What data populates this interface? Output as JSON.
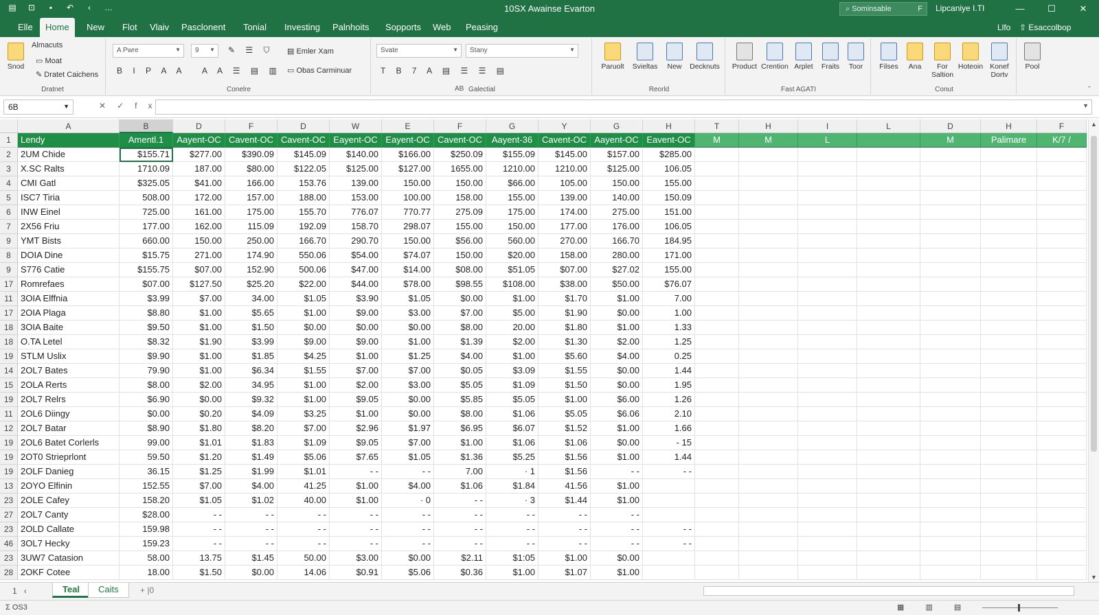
{
  "titlebar": {
    "quick_access_icons": [
      "excel-logo-icon",
      "autosave-icon",
      "save-icon",
      "undo-icon",
      "redo-icon",
      "more-icon"
    ],
    "quick_glyphs": [
      "▤",
      "⊡",
      "▪",
      "↶",
      "‹",
      "…"
    ],
    "title": "10SX Awainse Evarton",
    "search_placeholder": "Sominsable",
    "search_key": "F",
    "user": "Lipcaniye I.TI",
    "window_controls": [
      "—",
      "☐",
      "✕"
    ]
  },
  "tabs": [
    "Elle",
    "Home",
    "New",
    "Flot",
    "Vlaiv",
    "Pasclonent",
    "Tonial",
    "Investing",
    "Palnhoits",
    "Sopports",
    "Web",
    "Peasing"
  ],
  "active_tab": "Home",
  "tabs_right": [
    "Llfo",
    "Esaccolbop"
  ],
  "ribbon": {
    "clipboard": {
      "paste_label": "Snod",
      "items": [
        "Almacuts",
        "Moat",
        "Dratet Caichens"
      ],
      "group_label": "Dratnet"
    },
    "font": {
      "font_name": "A Pwre",
      "font_size": "9",
      "row1_glyphs": "✎ ☰ ⛉",
      "row2_glyphs": "B I P A A",
      "row3_glyphs": "A A ☰ ▤ ▥",
      "enter_label": "Emler Xam",
      "obas_label": "Obas Carminuar",
      "group_label": "Conelre"
    },
    "alignment": {
      "combo1": "Svate",
      "combo2": "Stany",
      "row_glyphs": "T B 7 A ▤ ☰ ☰ ▤",
      "label_ab": "AB",
      "group_label": "Galectial"
    },
    "records": {
      "buttons": [
        "Paruolt",
        "Svieltas",
        "New",
        "Decknuts"
      ],
      "group_label": "Reorld"
    },
    "fast": {
      "buttons": [
        "Product",
        "Crention",
        "Arplet",
        "Fraits",
        "Toor"
      ],
      "group_label": "Fast AGATI"
    },
    "count": {
      "buttons": [
        "Filses",
        "Ana",
        "For Saltion",
        "Hoteoin",
        "Konef Dortv"
      ],
      "group_label": "Conut"
    },
    "pool": {
      "buttons": [
        "Pool"
      ]
    }
  },
  "formula_bar": {
    "name_box": "6B",
    "icons": [
      "✕",
      "✓",
      "fx"
    ],
    "formula": ""
  },
  "columns": [
    "A",
    "B",
    "D",
    "F",
    "D",
    "W",
    "E",
    "F",
    "G",
    "Y",
    "G",
    "H",
    "T",
    "H",
    "I",
    "L",
    "D",
    "H",
    "F"
  ],
  "selected_column_index": 1,
  "header_row": {
    "row_num": "1",
    "cells": [
      "Lendy",
      "Amentl.1",
      "Aayent-OC",
      "Cavent-OC",
      "Cavent-OC",
      "Eayent-OC",
      "Eayent-OC",
      "Cavent-OC",
      "Aayent-36",
      "Cavent-OC",
      "Aayent-OC",
      "Eavent-OC",
      "M",
      "M",
      "L",
      "",
      "M",
      "Palimare",
      "K/7 /"
    ]
  },
  "rows": [
    {
      "n": "2",
      "cells": [
        "2UM Chide",
        "$155.71",
        "$277.00",
        "$390.09",
        "$145.09",
        "$140.00",
        "$166.00",
        "$250.09",
        "$155.09",
        "$145.00",
        "$157.00",
        "$285.00"
      ]
    },
    {
      "n": "3",
      "cells": [
        "X.SC Ralts",
        "1710.09",
        "187.00",
        "$80.00",
        "$122.05",
        "$125.00",
        "$127.00",
        "1655.00",
        "1210.00",
        "1210.00",
        "$125.00",
        "106.05"
      ]
    },
    {
      "n": "4",
      "cells": [
        "CMI Gatl",
        "$325.05",
        "$41.00",
        "166.00",
        "153.76",
        "139.00",
        "150.00",
        "150.00",
        "$66.00",
        "105.00",
        "150.00",
        "155.00"
      ]
    },
    {
      "n": "5",
      "cells": [
        "ISC7 Tiria",
        "508.00",
        "172.00",
        "157.00",
        "188.00",
        "153.00",
        "100.00",
        "158.00",
        "155.00",
        "139.00",
        "140.00",
        "150.09"
      ]
    },
    {
      "n": "6",
      "cells": [
        "INW Einel",
        "725.00",
        "161.00",
        "175.00",
        "155.70",
        "776.07",
        "770.77",
        "275.09",
        "175.00",
        "174.00",
        "275.00",
        "151.00"
      ]
    },
    {
      "n": "7",
      "cells": [
        "2X56 Friu",
        "177.00",
        "162.00",
        "115.09",
        "192.09",
        "158.70",
        "298.07",
        "155.00",
        "150.00",
        "177.00",
        "176.00",
        "106.05"
      ]
    },
    {
      "n": "9",
      "cells": [
        "YMT Bists",
        "660.00",
        "150.00",
        "250.00",
        "166.70",
        "290.70",
        "150.00",
        "$56.00",
        "560.00",
        "270.00",
        "166.70",
        "184.95"
      ]
    },
    {
      "n": "8",
      "cells": [
        "DOIA Dine",
        "$15.75",
        "271.00",
        "174.90",
        "550.06",
        "$54.00",
        "$74.07",
        "150.00",
        "$20.00",
        "158.00",
        "280.00",
        "171.00"
      ]
    },
    {
      "n": "9",
      "cells": [
        "S776 Catie",
        "$155.75",
        "$07.00",
        "152.90",
        "500.06",
        "$47.00",
        "$14.00",
        "$08.00",
        "$51.05",
        "$07.00",
        "$27.02",
        "155.00"
      ]
    },
    {
      "n": "17",
      "cells": [
        "Romrefaes",
        "$07.00",
        "$127.50",
        "$25.20",
        "$22.00",
        "$44.00",
        "$78.00",
        "$98.55",
        "$108.00",
        "$38.00",
        "$50.00",
        "$76.07"
      ]
    },
    {
      "n": "11",
      "cells": [
        "3OIA Elffnia",
        "$3.99",
        "$7.00",
        "34.00",
        "$1.05",
        "$3.90",
        "$1.05",
        "$0.00",
        "$1.00",
        "$1.70",
        "$1.00",
        "7.00"
      ]
    },
    {
      "n": "17",
      "cells": [
        "2OIA Plaga",
        "$8.80",
        "$1.00",
        "$5.65",
        "$1.00",
        "$9.00",
        "$3.00",
        "$7.00",
        "$5.00",
        "$1.90",
        "$0.00",
        "1.00"
      ]
    },
    {
      "n": "18",
      "cells": [
        "3OIA Baite",
        "$9.50",
        "$1.00",
        "$1.50",
        "$0.00",
        "$0.00",
        "$0.00",
        "$8.00",
        "20.00",
        "$1.80",
        "$1.00",
        "1.33"
      ]
    },
    {
      "n": "18",
      "cells": [
        "O.TA Letel",
        "$8.32",
        "$1.90",
        "$3.99",
        "$9.00",
        "$9.00",
        "$1.00",
        "$1.39",
        "$2.00",
        "$1.30",
        "$2.00",
        "1.25"
      ]
    },
    {
      "n": "19",
      "cells": [
        "STLM Uslix",
        "$9.90",
        "$1.00",
        "$1.85",
        "$4.25",
        "$1.00",
        "$1.25",
        "$4.00",
        "$1.00",
        "$5.60",
        "$4.00",
        "0.25"
      ]
    },
    {
      "n": "14",
      "cells": [
        "2OL7 Bates",
        "79.90",
        "$1.00",
        "$6.34",
        "$1.55",
        "$7.00",
        "$7.00",
        "$0.05",
        "$3.09",
        "$1.55",
        "$0.00",
        "1.44"
      ]
    },
    {
      "n": "15",
      "cells": [
        "2OLA Rerts",
        "$8.00",
        "$2.00",
        "34.95",
        "$1.00",
        "$2.00",
        "$3.00",
        "$5.05",
        "$1.09",
        "$1.50",
        "$0.00",
        "1.95"
      ]
    },
    {
      "n": "19",
      "cells": [
        "2OL7 Relrs",
        "$6.90",
        "$0.00",
        "$9.32",
        "$1.00",
        "$9.05",
        "$0.00",
        "$5.85",
        "$5.05",
        "$1.00",
        "$6.00",
        "1.26"
      ]
    },
    {
      "n": "11",
      "cells": [
        "2OL6 Diingy",
        "$0.00",
        "$0.20",
        "$4.09",
        "$3.25",
        "$1.00",
        "$0.00",
        "$8.00",
        "$1.06",
        "$5.05",
        "$6.06",
        "2.10"
      ]
    },
    {
      "n": "12",
      "cells": [
        "2OL7 Batar",
        "$8.90",
        "$1.80",
        "$8.20",
        "$7.00",
        "$2.96",
        "$1.97",
        "$6.95",
        "$6.07",
        "$1.52",
        "$1.00",
        "1.66"
      ]
    },
    {
      "n": "19",
      "cells": [
        "2OL6 Batet Corlerls",
        "99.00",
        "$1.01",
        "$1.83",
        "$1.09",
        "$9.05",
        "$7.00",
        "$1.00",
        "$1.06",
        "$1.06",
        "$0.00",
        "- 15"
      ]
    },
    {
      "n": "19",
      "cells": [
        "2OT0 Strieprlont",
        "59.50",
        "$1.20",
        "$1.49",
        "$5.06",
        "$7.65",
        "$1.05",
        "$1.36",
        "$5.25",
        "$1.56",
        "$1.00",
        "1.44"
      ]
    },
    {
      "n": "19",
      "cells": [
        "2OLF Danieg",
        "36.15",
        "$1.25",
        "$1.99",
        "$1.01",
        "-  -",
        "-  -",
        "7.00",
        "·  1",
        "$1.56",
        "-  -",
        "-  -"
      ]
    },
    {
      "n": "13",
      "cells": [
        "2OYO Elfinin",
        "152.55",
        "$7.00",
        "$4.00",
        "41.25",
        "$1.00",
        "$4.00",
        "$1.06",
        "$1.84",
        "41.56",
        "$1.00",
        ""
      ]
    },
    {
      "n": "23",
      "cells": [
        "2OLE Cafey",
        "158.20",
        "$1.05",
        "$1.02",
        "40.00",
        "$1.00",
        "·  0",
        "-  -",
        "·  3",
        "$1.44",
        "$1.00",
        ""
      ]
    },
    {
      "n": "27",
      "cells": [
        "2OL7 Canty",
        "$28.00",
        "-  -",
        "-  -",
        "-  -",
        "-  -",
        "-  -",
        "-  -",
        "-  -",
        "-  -",
        "-  -",
        ""
      ]
    },
    {
      "n": "23",
      "cells": [
        "2OLD Callate",
        "159.98",
        "-  -",
        "-  -",
        "-  -",
        "-  -",
        "-  -",
        "-  -",
        "-  -",
        "-  -",
        "-  -",
        "-  -"
      ]
    },
    {
      "n": "46",
      "cells": [
        "3OL7 Hecky",
        "159.23",
        "-  -",
        "-  -",
        "-  -",
        "-  -",
        "-  -",
        "-  -",
        "-  -",
        "-  -",
        "-  -",
        "-  -"
      ]
    },
    {
      "n": "23",
      "cells": [
        "3UW7 Catasion",
        "58.00",
        "13.75",
        "$1.45",
        "50.00",
        "$3.00",
        "$0.00",
        "$2.11",
        "$1:05",
        "$1.00",
        "$0.00",
        ""
      ]
    },
    {
      "n": "28",
      "cells": [
        "2OKF Cotee",
        "18.00",
        "$1.50",
        "$0.00",
        "14.06",
        "$0.91",
        "$5.06",
        "$0.36",
        "$1.00",
        "$1.07",
        "$1.00",
        ""
      ]
    }
  ],
  "sheets": [
    "Teal",
    "Caits"
  ],
  "active_sheet": "Teal",
  "sheet_nav": [
    "1",
    "‹",
    "+",
    "|0"
  ],
  "status": {
    "left": "Σ OS3",
    "view_glyphs": "▦ ▥ ▤"
  }
}
